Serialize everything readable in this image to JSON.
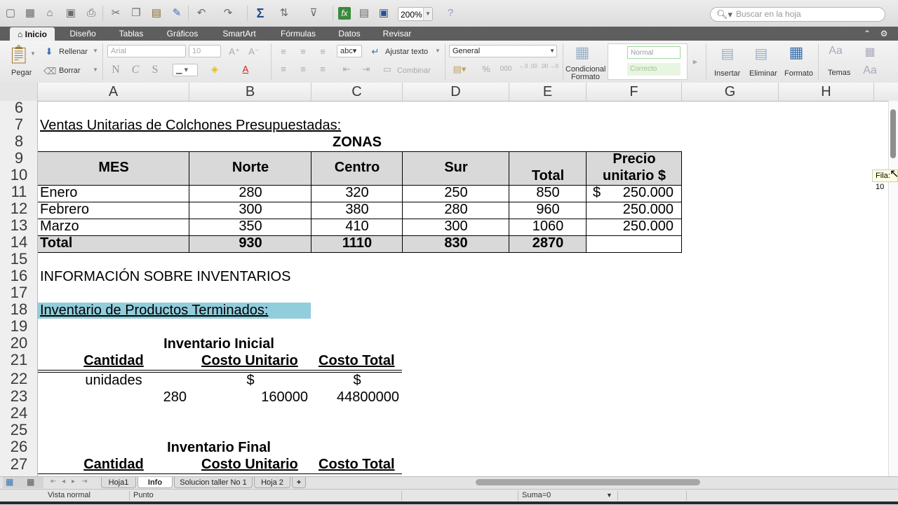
{
  "toolbar": {
    "zoom": "200%",
    "search_placeholder": "Buscar en la hoja"
  },
  "ribbon_tabs": [
    "Inicio",
    "Diseño",
    "Tablas",
    "Gráficos",
    "SmartArt",
    "Fórmulas",
    "Datos",
    "Revisar"
  ],
  "ribbon": {
    "paste": "Pegar",
    "fill": "Rellenar",
    "clear": "Borrar",
    "font": "Arial",
    "font_size": "10",
    "bold": "N",
    "italic": "C",
    "underline": "S",
    "wrap_prefix": "abc",
    "wrap_text": "Ajustar texto",
    "merge": "Combinar",
    "number_format": "General",
    "cond_format_1": "Condicional",
    "cond_format_2": "Formato",
    "style_normal": "Normal",
    "style_correcto": "Correcto",
    "insert": "Insertar",
    "delete": "Eliminar",
    "format": "Formato",
    "themes": "Temas",
    "percent": "%",
    "thousands": "000",
    "dec_inc": "←0 .00",
    "dec_dec": ".00 →0"
  },
  "columns": [
    "A",
    "B",
    "C",
    "D",
    "E",
    "F",
    "G",
    "H"
  ],
  "rows": [
    "6",
    "7",
    "8",
    "9",
    "10",
    "11",
    "12",
    "13",
    "14",
    "15",
    "16",
    "17",
    "18",
    "19",
    "20",
    "21",
    "22",
    "23",
    "24",
    "25",
    "26",
    "27"
  ],
  "sheet": {
    "title": "Ventas Unitarias de Colchones Presupuestadas:",
    "zonas": "ZONAS",
    "headers": {
      "mes": "MES",
      "norte": "Norte",
      "centro": "Centro",
      "sur": "Sur",
      "total": "Total",
      "precio_1": "Precio",
      "precio_2": "unitario $"
    },
    "months": [
      {
        "mes": "Enero",
        "norte": "280",
        "centro": "320",
        "sur": "250",
        "total": "850",
        "precio_symbol": "$",
        "precio": "250.000"
      },
      {
        "mes": "Febrero",
        "norte": "300",
        "centro": "380",
        "sur": "280",
        "total": "960",
        "precio_symbol": "",
        "precio": "250.000"
      },
      {
        "mes": "Marzo",
        "norte": "350",
        "centro": "410",
        "sur": "300",
        "total": "1060",
        "precio_symbol": "",
        "precio": "250.000"
      }
    ],
    "totals": {
      "label": "Total",
      "norte": "930",
      "centro": "1110",
      "sur": "830",
      "total": "2870"
    },
    "info_title": "INFORMACIÓN SOBRE INVENTARIOS",
    "inv_pt_title": "Inventario de Productos Terminados:",
    "inv_inicial": {
      "title": "Inventario Inicial",
      "col_cantidad": "Cantidad",
      "col_costo_unitario": "Costo Unitario",
      "col_costo_total": "Costo Total",
      "units_label": "unidades",
      "cu_symbol": "$",
      "ct_symbol": "$",
      "cantidad": "280",
      "costo_unitario": "160000",
      "costo_total": "44800000"
    },
    "inv_final": {
      "title": "Inventario Final",
      "col_cantidad": "Cantidad",
      "col_costo_unitario": "Costo Unitario",
      "col_costo_total": "Costo Total"
    }
  },
  "tooltip": "Fila: 10",
  "sheet_tabs": [
    "Hoja1",
    "Info",
    "Solucion taller No 1",
    "Hoja 2"
  ],
  "active_sheet": "Info",
  "status": {
    "view": "Vista normal",
    "mode": "Punto",
    "sum": "Suma=0"
  },
  "colors": {
    "highlight_cyan": "#92cddc",
    "header_gray": "#d9d9d9",
    "ribbon_tabs_bg": "#5e5e5e"
  }
}
